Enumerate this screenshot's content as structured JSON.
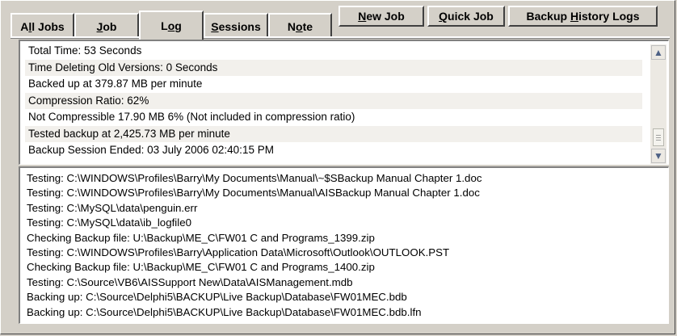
{
  "tabs": [
    {
      "pre": "A",
      "u": "l",
      "post": "l Jobs"
    },
    {
      "pre": "",
      "u": "J",
      "post": "ob"
    },
    {
      "pre": "L",
      "u": "o",
      "post": "g"
    },
    {
      "pre": "",
      "u": "S",
      "post": "essions"
    },
    {
      "pre": "N",
      "u": "o",
      "post": "te"
    }
  ],
  "active_tab": "Log",
  "buttons": [
    {
      "pre": "",
      "u": "N",
      "post": "ew Job"
    },
    {
      "pre": "",
      "u": "Q",
      "post": "uick Job"
    },
    {
      "pre": "Backup ",
      "u": "H",
      "post": "istory Logs"
    }
  ],
  "summary": [
    "Total Time: 53 Seconds",
    "Time Deleting Old Versions: 0 Seconds",
    "Backed up at 379.87 MB per minute",
    "Compression Ratio: 62%",
    "Not Compressible 17.90 MB 6% (Not included in compression ratio)",
    "Tested backup at 2,425.73 MB per minute",
    "Backup Session Ended: 03 July 2006 02:40:15 PM"
  ],
  "scrollbar": {
    "up": "▲",
    "down": "▼"
  },
  "log": [
    "Testing: C:\\WINDOWS\\Profiles\\Barry\\My Documents\\Manual\\~$SBackup Manual Chapter 1.doc",
    "Testing: C:\\WINDOWS\\Profiles\\Barry\\My Documents\\Manual\\AISBackup Manual Chapter 1.doc",
    "Testing: C:\\MySQL\\data\\penguin.err",
    "Testing: C:\\MySQL\\data\\ib_logfile0",
    "Checking Backup file: U:\\Backup\\ME_C\\FW01 C and Programs_1399.zip",
    "Testing: C:\\WINDOWS\\Profiles\\Barry\\Application Data\\Microsoft\\Outlook\\OUTLOOK.PST",
    "Checking Backup file: U:\\Backup\\ME_C\\FW01 C and Programs_1400.zip",
    "Testing: C:\\Source\\VB6\\AISSupport New\\Data\\AISManagement.mdb",
    "Backing up: C:\\Source\\Delphi5\\BACKUP\\Live Backup\\Database\\FW01MEC.bdb",
    "Backing up: C:\\Source\\Delphi5\\BACKUP\\Live Backup\\Database\\FW01MEC.bdb.lfn"
  ]
}
